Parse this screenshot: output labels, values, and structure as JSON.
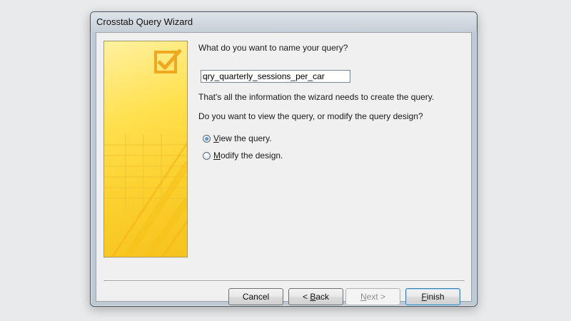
{
  "window": {
    "title": "Crosstab Query Wizard"
  },
  "main": {
    "name_prompt": "What do you want to name your query?",
    "query_name": "qry_quarterly_sessions_per_car",
    "info_text": "That's all the information the wizard needs to create the query.",
    "view_prompt": "Do you want to view the query, or modify the query design?",
    "options": [
      {
        "label_prefix": "",
        "accel": "V",
        "label_rest": "iew the query.",
        "checked": true
      },
      {
        "label_prefix": "",
        "accel": "M",
        "label_rest": "odify the design.",
        "checked": false
      }
    ]
  },
  "buttons": {
    "cancel": "Cancel",
    "back_prefix": "< ",
    "back_accel": "B",
    "back_rest": "ack",
    "next_prefix": "",
    "next_accel": "N",
    "next_rest": "ext >",
    "finish_prefix": "",
    "finish_accel": "F",
    "finish_rest": "inish"
  },
  "colors": {
    "accent": "#3c7fb1",
    "art_yellow": "#fbcf2c"
  },
  "icons": {
    "art": "checkbox-check-icon"
  }
}
